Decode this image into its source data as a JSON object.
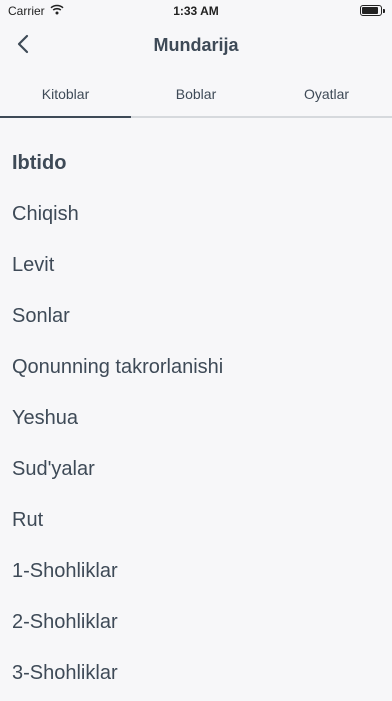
{
  "status": {
    "carrier": "Carrier",
    "time": "1:33 AM"
  },
  "nav": {
    "title": "Mundarija"
  },
  "tabs": [
    {
      "label": "Kitoblar"
    },
    {
      "label": "Boblar"
    },
    {
      "label": "Oyatlar"
    }
  ],
  "books": [
    "Ibtido",
    "Chiqish",
    "Levit",
    "Sonlar",
    "Qonunning takrorlanishi",
    "Yeshua",
    "Sud'yalar",
    "Rut",
    "1-Shohliklar",
    "2-Shohliklar",
    "3-Shohliklar"
  ],
  "icons": {
    "back": "chevron-left-icon",
    "wifi": "wifi-icon",
    "battery": "battery-icon"
  },
  "colors": {
    "text": "#3e4a57",
    "background": "#f7f7f9",
    "tab_underline": "#3e4a57"
  }
}
